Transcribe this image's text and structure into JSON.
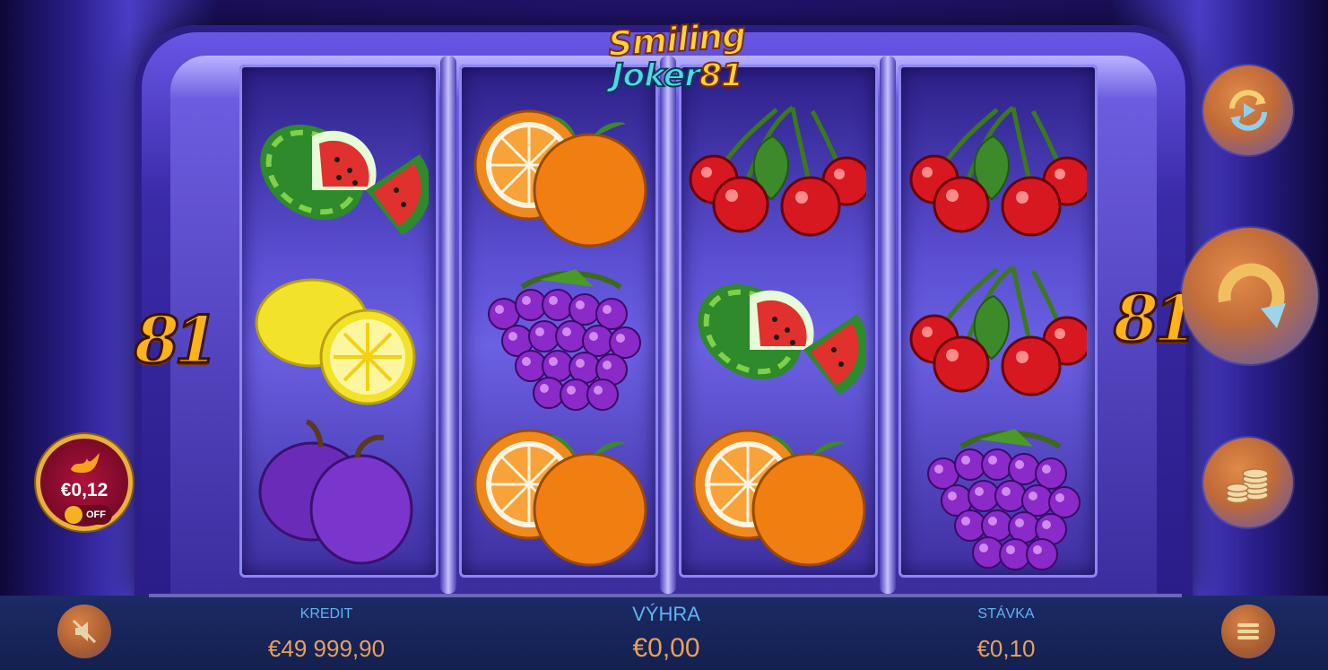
{
  "game": {
    "logo_line1": "Smiling",
    "logo_line2": "Joker",
    "logo_line3": "81",
    "badge_left": "81",
    "badge_right": "81"
  },
  "reels": [
    [
      "watermelon",
      "lemon",
      "plum"
    ],
    [
      "orange",
      "grapes",
      "orange"
    ],
    [
      "cherries",
      "watermelon",
      "orange"
    ],
    [
      "cherries",
      "cherries",
      "grapes"
    ]
  ],
  "bonus": {
    "value": "€0,12",
    "toggle_label": "OFF"
  },
  "bottom_bar": {
    "credit_label": "KREDIT",
    "credit_value": "€49 999,90",
    "win_label": "VÝHRA",
    "win_value": "€0,00",
    "bet_label": "STÁVKA",
    "bet_value": "€0,10"
  },
  "controls": {
    "autoplay_icon": "autoplay-icon",
    "spin_icon": "spin-icon",
    "coins_icon": "coins-icon",
    "mute_icon": "mute-icon",
    "menu_icon": "menu-icon"
  }
}
